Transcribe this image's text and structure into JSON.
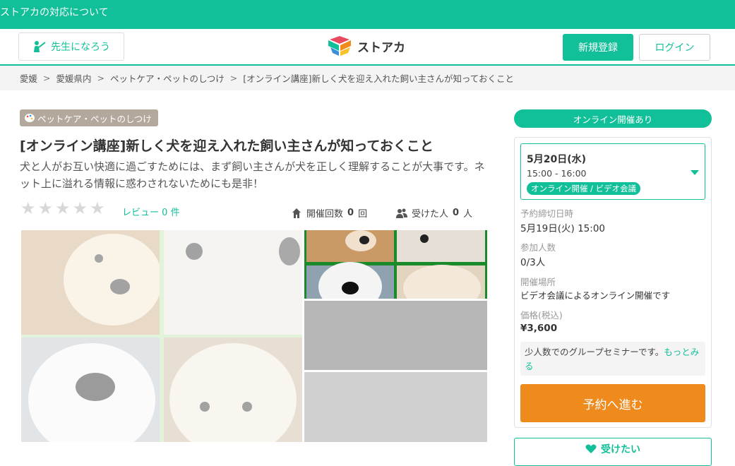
{
  "topbar": {
    "text": "ストアカの対応について"
  },
  "header": {
    "teacher_label": "先生になろう",
    "logo_text": "ストアカ",
    "signup_label": "新規登録",
    "login_label": "ログイン"
  },
  "breadcrumb": {
    "items": [
      "愛媛",
      "愛媛県内",
      "ペットケア・ペットのしつけ",
      "[オンライン講座]新しく犬を迎え入れた飼い主さんが知っておくこと"
    ],
    "separator": ">"
  },
  "course": {
    "category": "ペットケア・ペットのしつけ",
    "title": "[オンライン講座]新しく犬を迎え入れた飼い主さんが知っておくこと",
    "description": "犬と人がお互い快適に過ごすためには、まず飼い主さんが犬を正しく理解することが大事です。ネット上に溢れる情報に惑わされないためにも是非！",
    "rating_stars": 0,
    "star_glyph": "★",
    "review_label": "レビュー",
    "review_count": "0",
    "review_unit": "件",
    "sessions_label": "開催回数",
    "sessions_count": "0",
    "sessions_unit": "回",
    "attendees_label": "受けた人",
    "attendees_count": "0",
    "attendees_unit": "人"
  },
  "sidebar": {
    "online_pill": "オンライン開催あり",
    "date": "5月20日(水)",
    "time": "15:00 - 16:00",
    "date_badge": "オンライン開催 / ビデオ会議",
    "deadline_label": "予約締切日時",
    "deadline_value": "5月19日(火) 15:00",
    "participants_label": "参加人数",
    "participants_value": "0/3人",
    "venue_label": "開催場所",
    "venue_value": "ビデオ会議によるオンライン開催です",
    "price_label": "価格(税込)",
    "price_value": "¥3,600",
    "note_text": "少人数でのグループセミナーです。",
    "note_more": "もっとみる",
    "reserve_label": "予約へ進む",
    "wish_label": "受けたい"
  },
  "colors": {
    "brand_green": "#11bf98",
    "reserve_orange": "#ef8a1d",
    "category_tag": "#b2a99c"
  }
}
